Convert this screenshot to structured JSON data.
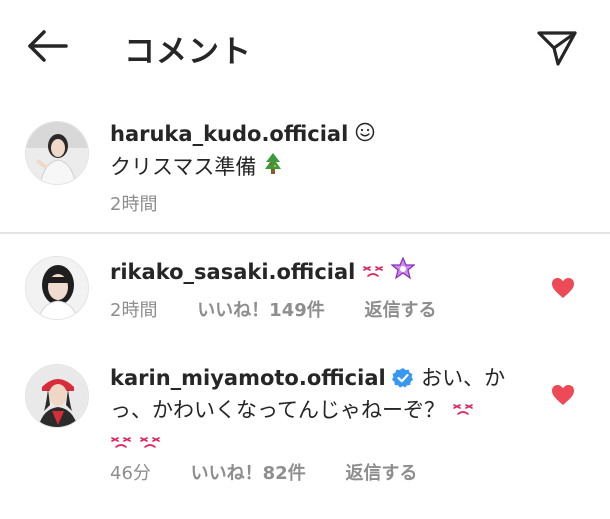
{
  "header": {
    "title": "コメント",
    "back_icon": "arrow-left-icon",
    "send_icon": "paper-plane-icon"
  },
  "caption": {
    "username": "haruka_kudo.official",
    "badge_icon": "smiley-icon",
    "text": "クリスマス準備",
    "emoji": "christmas-tree-icon",
    "time": "2時間"
  },
  "comments": [
    {
      "username": "rikako_sasaki.official",
      "text": "",
      "emojis": [
        "weary-face-icon",
        "purple-flower-icon"
      ],
      "time": "2時間",
      "likes": "いいね！149件",
      "reply": "返信する",
      "liked": true
    },
    {
      "username": "karin_miyamoto.official",
      "verified": true,
      "text_line1": "おい、か",
      "text_line2": "っ、かわいくなってんじゃねーぞ？",
      "emojis": [
        "weary-face-icon",
        "weary-face-icon",
        "weary-face-icon"
      ],
      "time": "46分",
      "likes": "いいね！82件",
      "reply": "返信する",
      "liked": true
    }
  ],
  "colors": {
    "heart": "#ed4956",
    "verified": "#3897f0",
    "meta_text": "#8e8e8e",
    "emoji_pink": "#e0245e",
    "flower_purple": "#b04ad6"
  }
}
